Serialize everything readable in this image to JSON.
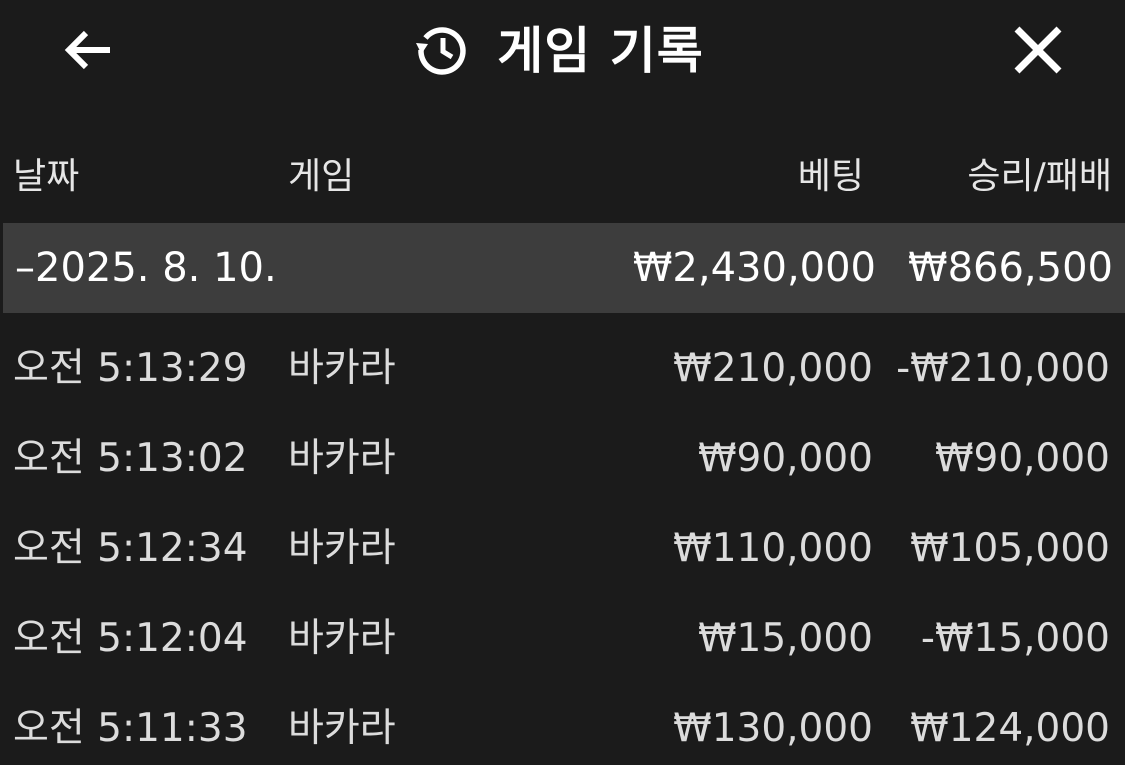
{
  "header": {
    "title": "게임 기록",
    "back_icon": "arrow-left-icon",
    "history_icon": "history-icon",
    "close_icon": "close-icon"
  },
  "columns": {
    "date": "날짜",
    "game": "게임",
    "bet": "베팅",
    "result": "승리/패배"
  },
  "date_group": {
    "date": "–2025. 8. 10.",
    "bet_total": "₩2,430,000",
    "result_total": "₩866,500"
  },
  "rows": [
    {
      "time": "오전 5:13:29",
      "game": "바카라",
      "bet": "₩210,000",
      "result": "-₩210,000"
    },
    {
      "time": "오전 5:13:02",
      "game": "바카라",
      "bet": "₩90,000",
      "result": "₩90,000"
    },
    {
      "time": "오전 5:12:34",
      "game": "바카라",
      "bet": "₩110,000",
      "result": "₩105,000"
    },
    {
      "time": "오전 5:12:04",
      "game": "바카라",
      "bet": "₩15,000",
      "result": "-₩15,000"
    },
    {
      "time": "오전 5:11:33",
      "game": "바카라",
      "bet": "₩130,000",
      "result": "₩124,000"
    }
  ],
  "colors": {
    "background": "#1b1b1b",
    "date_row_background": "#3d3d3d",
    "text": "#ffffff"
  }
}
